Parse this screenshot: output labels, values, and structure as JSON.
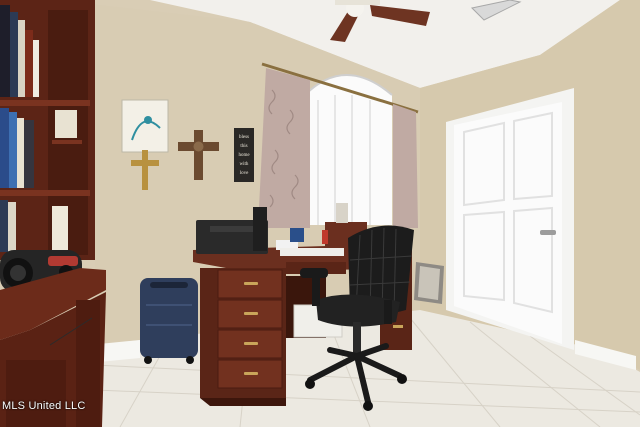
{
  "photo": {
    "watermark": "MLS United LLC",
    "scene": "home office",
    "colors": {
      "wall": "#d9cdb5",
      "ceiling": "#f1efeb",
      "floor": "#ece9e2",
      "desk_wood": "#6b2f1f",
      "curtain": "#bfa9a3",
      "door": "#fbfbfb",
      "chair": "#1b1b1b",
      "luggage": "#2f3e5c"
    }
  },
  "wall_sign": {
    "lines": [
      "bless",
      "this",
      "home",
      "with",
      "love"
    ]
  }
}
